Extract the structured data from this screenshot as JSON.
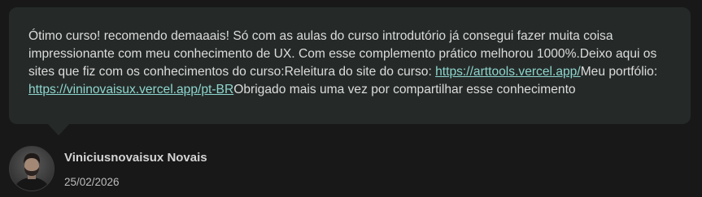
{
  "review": {
    "text_1": "Ótimo curso! recomendo demaaais! Só com as aulas do curso introdutório já consegui fazer muita coisa impressionante com meu conhecimento de UX. Com esse complemento prático melhorou 1000%.Deixo aqui os sites que fiz com os conhecimentos do curso:Releitura do site do curso: ",
    "link_1": "https://arttools.vercel.app/",
    "text_2": "Meu portfólio: ",
    "link_2": "https://vininovaisux.vercel.app/pt-BR",
    "text_3": "Obrigado mais uma vez por compartilhar esse conhecimento"
  },
  "author": {
    "name": "Viniciusnovaisux Novais",
    "date": "25/02/2026",
    "avatar_icon": "user-photo-avatar"
  },
  "colors": {
    "background": "#181818",
    "bubble": "#252a28",
    "text": "#dcdcdc",
    "link": "#8fd6cf"
  }
}
